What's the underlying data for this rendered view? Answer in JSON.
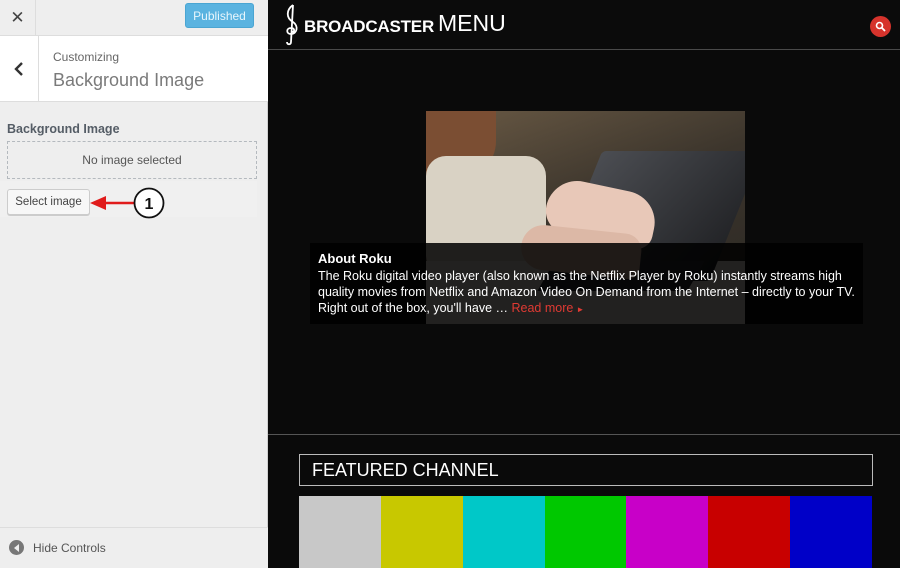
{
  "sidebar": {
    "close_glyph": "✕",
    "publish_label": "Published",
    "breadcrumb_small": "Customizing",
    "breadcrumb_title": "Background Image",
    "control_label": "Background Image",
    "placeholder_text": "No image selected",
    "select_image_label": "Select image",
    "callout_number": "1",
    "hide_controls_label": "Hide Controls"
  },
  "preview": {
    "logo_text": "BROADCASTER",
    "menu_label": "MENU",
    "caption": {
      "title": "About Roku",
      "body": "The Roku digital video player (also known as the Netflix Player by Roku) instantly streams high quality movies from Netflix and Amazon Video On Demand from the Internet – directly to your TV. Right out of the box, you'll have … ",
      "read_more": "Read more",
      "read_more_arrow": "►"
    },
    "featured_title": "FEATURED CHANNEL",
    "color_bars": [
      "#c8c8c8",
      "#c8c800",
      "#00c8c8",
      "#00c800",
      "#c800c8",
      "#c80000",
      "#0000c8"
    ]
  },
  "colors": {
    "accent_blue": "#5ab3e0",
    "accent_red": "#d6332c"
  }
}
